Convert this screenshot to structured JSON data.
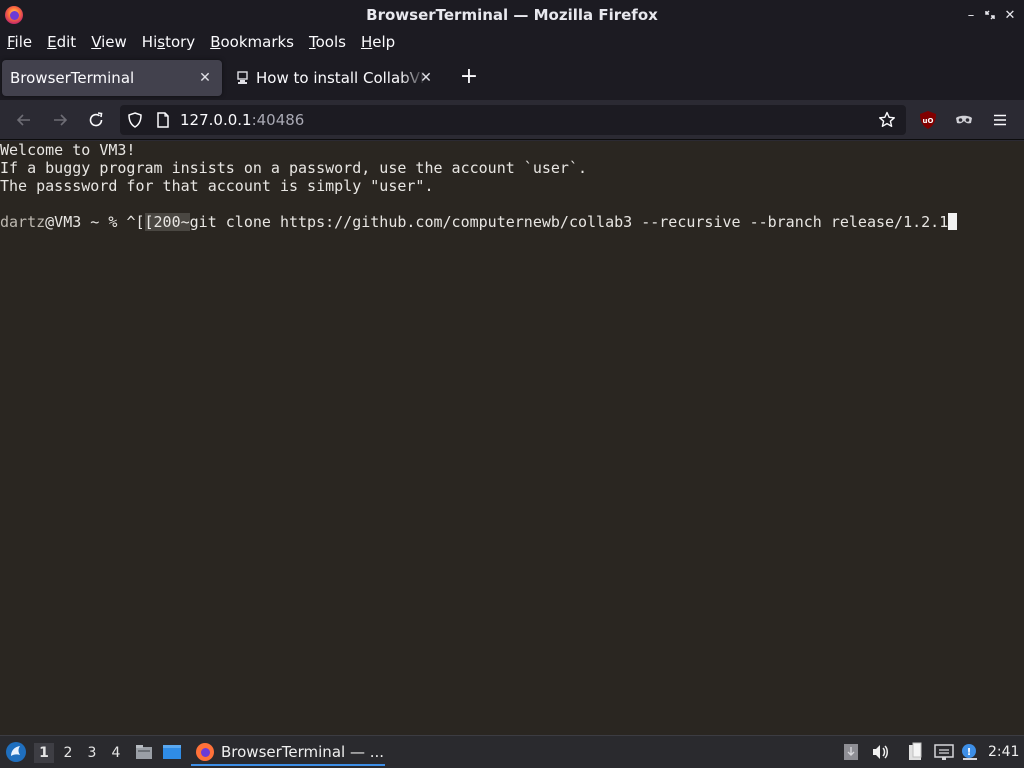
{
  "window": {
    "title": "BrowserTerminal — Mozilla Firefox"
  },
  "menubar": {
    "items": [
      {
        "pre": "",
        "u": "F",
        "post": "ile"
      },
      {
        "pre": "",
        "u": "E",
        "post": "dit"
      },
      {
        "pre": "",
        "u": "V",
        "post": "iew"
      },
      {
        "pre": "Hi",
        "u": "s",
        "post": "tory"
      },
      {
        "pre": "",
        "u": "B",
        "post": "ookmarks"
      },
      {
        "pre": "",
        "u": "T",
        "post": "ools"
      },
      {
        "pre": "",
        "u": "H",
        "post": "elp"
      }
    ]
  },
  "tabs": [
    {
      "label": "BrowserTerminal",
      "active": true
    },
    {
      "label": "How to install CollabVM",
      "active": false
    }
  ],
  "navbar": {
    "url_host": "127.0.0.1",
    "url_port": ":40486"
  },
  "terminal": {
    "lines": [
      "Welcome to VM3!",
      "If a buggy program insists on a password, use the account `user`.",
      "The passsword for that account is simply \"user\"."
    ],
    "prompt_user": "dartz",
    "prompt_rest": "@VM3 ~ % ",
    "paste_prefix_a": "^[",
    "paste_prefix_b": "[200~",
    "command": "git clone https://github.com/computernewb/collab3 --recursive --branch release/1.2.1"
  },
  "taskbar": {
    "workspaces": [
      "1",
      "2",
      "3",
      "4"
    ],
    "active_workspace": "1",
    "task_label": "BrowserTerminal — ...",
    "clock": "2:41"
  },
  "colors": {
    "terminal_bg": "#2a2621",
    "accent": "#3d8ee6"
  }
}
